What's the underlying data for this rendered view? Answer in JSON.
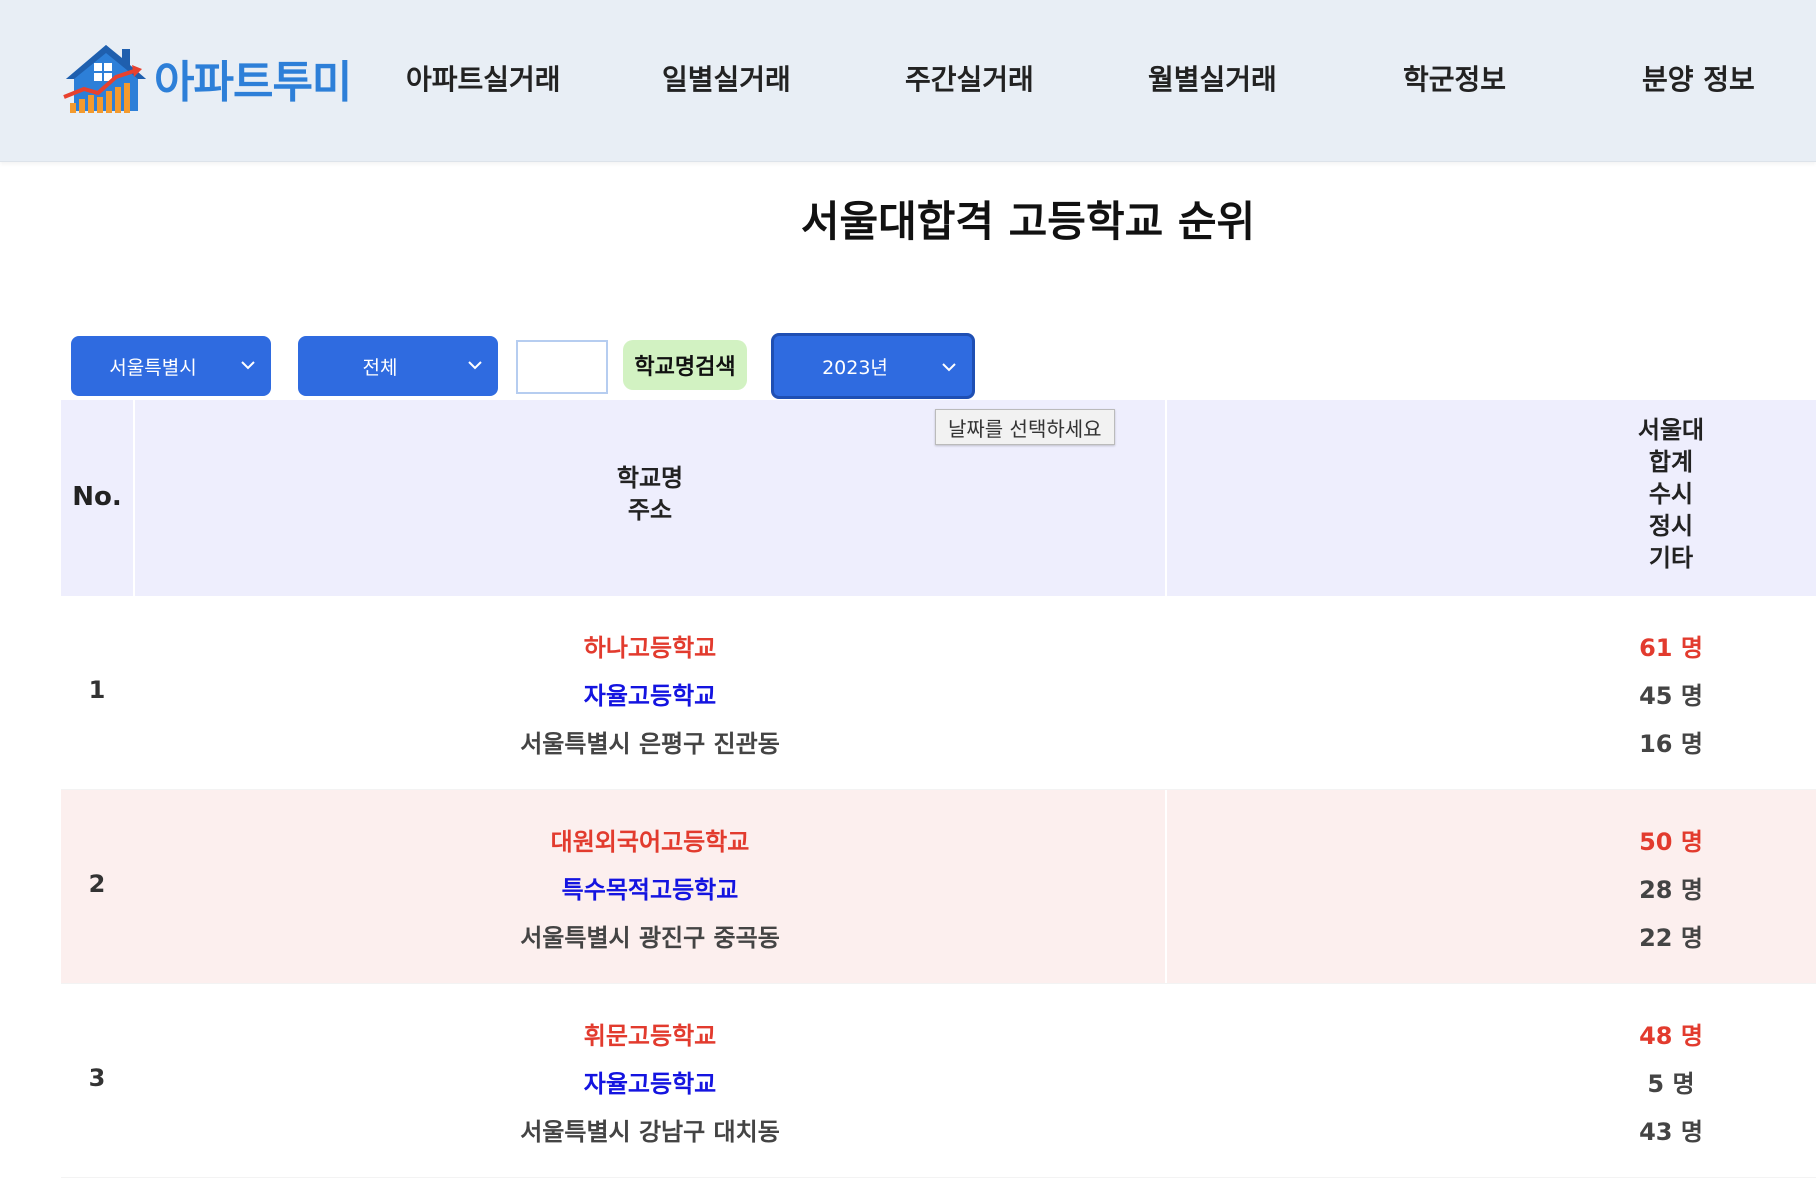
{
  "brand": {
    "name": "아파트투미",
    "color": "#2d7fd8"
  },
  "nav": [
    {
      "label": "아파트실거래"
    },
    {
      "label": "일별실거래"
    },
    {
      "label": "주간실거래"
    },
    {
      "label": "월별실거래"
    },
    {
      "label": "학군정보"
    },
    {
      "label": "분양 정보"
    }
  ],
  "page": {
    "title": "서울대합격 고등학교 순위"
  },
  "filters": {
    "region": "서울특별시",
    "district": "전체",
    "school_query": "",
    "search_button": "학교명검색",
    "year": "2023년",
    "tooltip": "날짜를 선택하세요"
  },
  "table": {
    "headers": {
      "no": "No.",
      "school_lines": [
        "학교명",
        "주소"
      ],
      "stats_lines": [
        "서울대",
        "합계",
        "수시",
        "정시",
        "기타"
      ]
    },
    "rows": [
      {
        "no": "1",
        "name": "하나고등학교",
        "type": "자율고등학교",
        "address": "서울특별시 은평구 진관동",
        "total": "61 명",
        "early": "45 명",
        "regular": "16 명"
      },
      {
        "no": "2",
        "name": "대원외국어고등학교",
        "type": "특수목적고등학교",
        "address": "서울특별시 광진구 중곡동",
        "total": "50 명",
        "early": "28 명",
        "regular": "22 명"
      },
      {
        "no": "3",
        "name": "휘문고등학교",
        "type": "자율고등학교",
        "address": "서울특별시 강남구 대치동",
        "total": "48 명",
        "early": "5 명",
        "regular": "43 명"
      }
    ]
  },
  "colors": {
    "header_bg": "#e8eef5",
    "select_bg": "#2f6be0",
    "search_bg": "#d2f2c2",
    "table_head_bg": "#eeeefd",
    "alt_row_bg": "#fcefee",
    "highlight_red": "#e23b2e",
    "type_blue": "#1414e0"
  }
}
